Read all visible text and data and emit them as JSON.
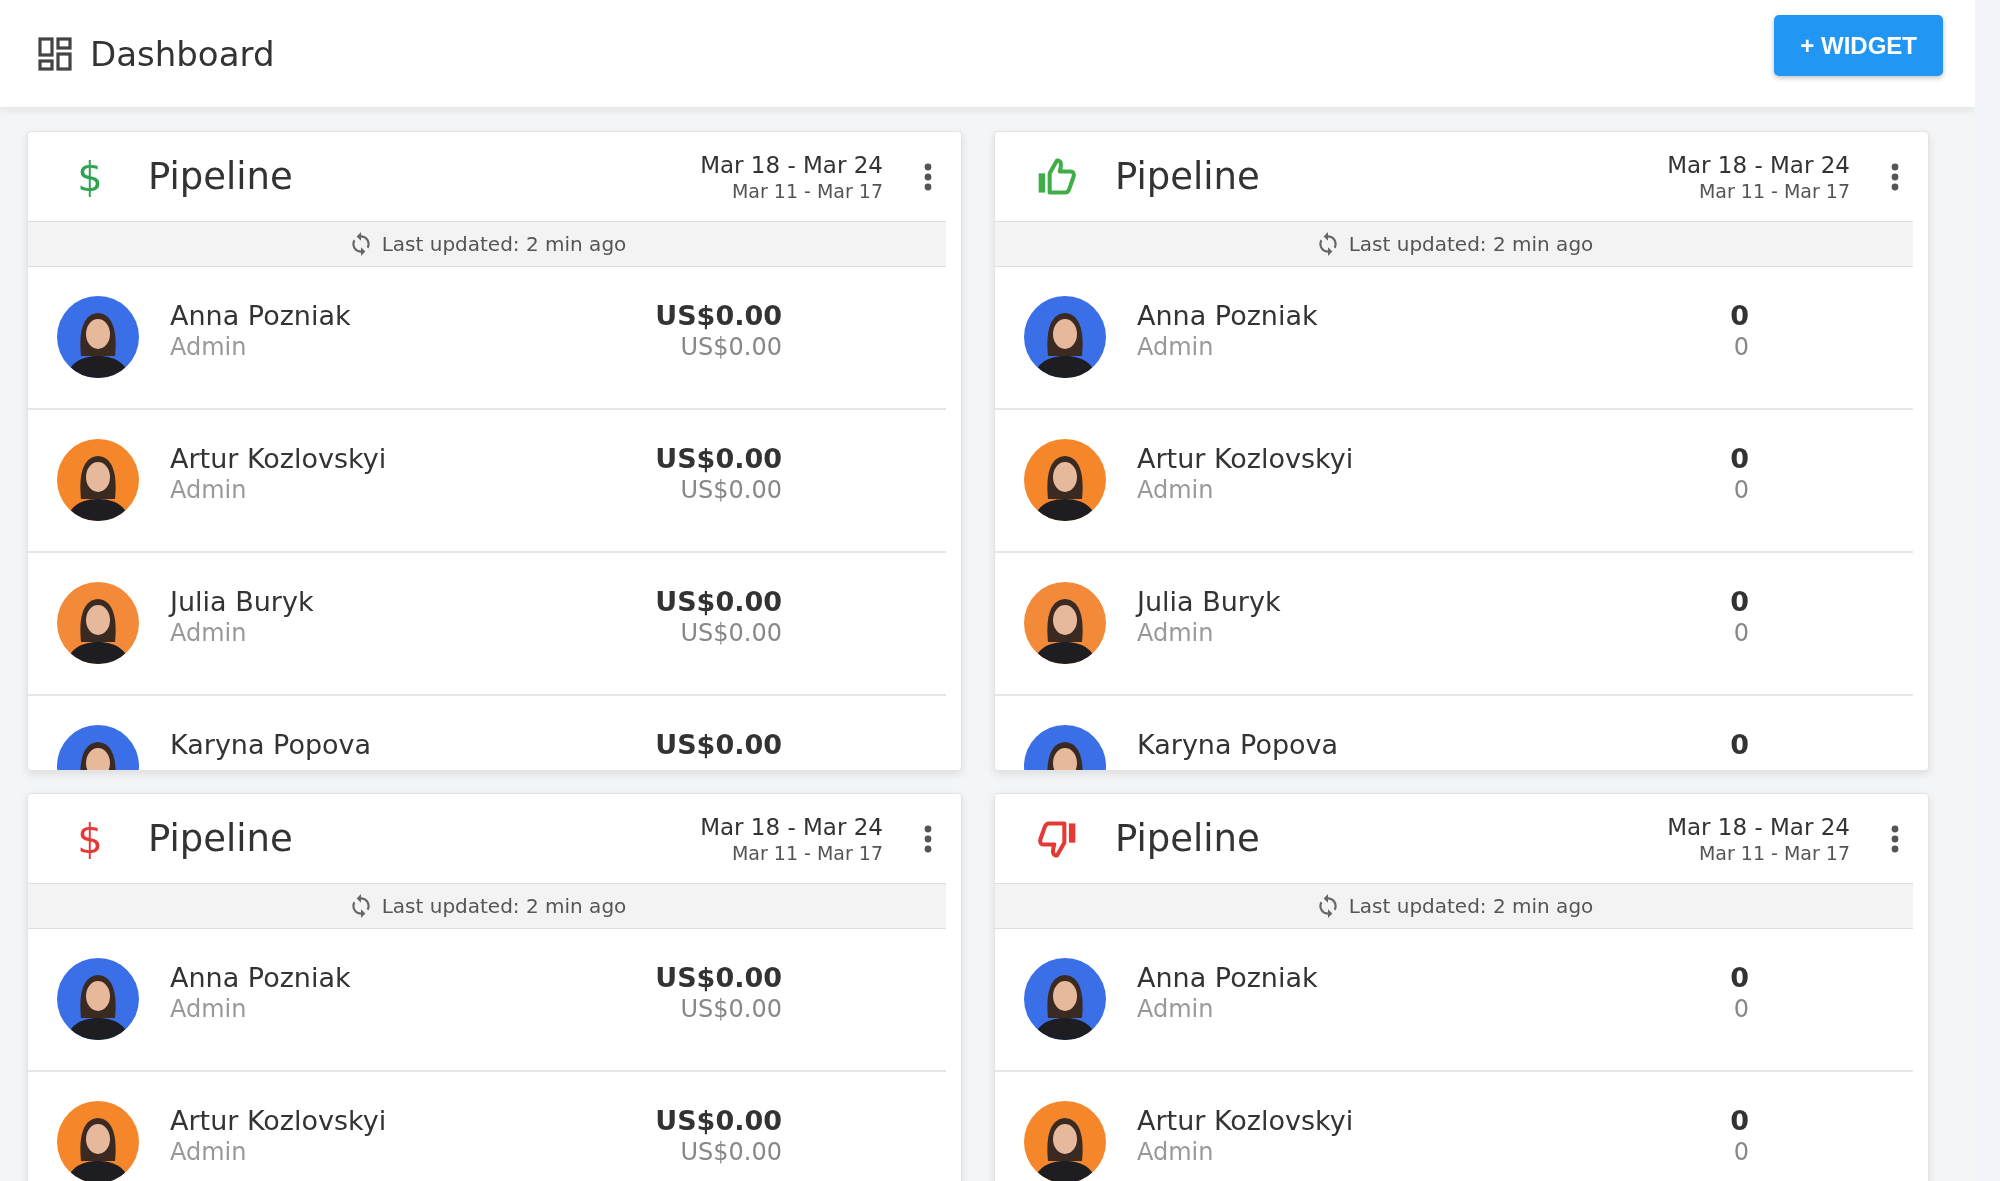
{
  "header": {
    "title": "Dashboard",
    "add_button": "+ WIDGET"
  },
  "widgets": [
    {
      "title": "Pipeline",
      "icon": {
        "kind": "glyph",
        "glyph": "$"
      },
      "color": "#2ea44f",
      "current_range": "Mar 18 - Mar 24",
      "previous_range": "Mar 11 - Mar 17",
      "updated": "Last updated: 2 min ago",
      "rows": [
        {
          "name": "Anna Pozniak",
          "role": "Admin",
          "color": "#3b6fe8",
          "value": "US$0.00",
          "previous": "US$0.00"
        },
        {
          "name": "Artur Kozlovskyi",
          "role": "Admin",
          "color": "#f5872a",
          "value": "US$0.00",
          "previous": "US$0.00"
        },
        {
          "name": "Julia Buryk",
          "role": "Admin",
          "color": "#f28a3a",
          "value": "US$0.00",
          "previous": "US$0.00"
        },
        {
          "name": "Karyna Popova",
          "color": "#3b6fe8",
          "value": "US$0.00"
        }
      ]
    },
    {
      "title": "Pipeline",
      "icon": {
        "kind": "thumbs-up"
      },
      "color": "#3fae49",
      "current_range": "Mar 18 - Mar 24",
      "previous_range": "Mar 11 - Mar 17",
      "updated": "Last updated: 2 min ago",
      "rows": [
        {
          "name": "Anna Pozniak",
          "role": "Admin",
          "color": "#3b6fe8",
          "value": "0",
          "previous": "0"
        },
        {
          "name": "Artur Kozlovskyi",
          "role": "Admin",
          "color": "#f5872a",
          "value": "0",
          "previous": "0"
        },
        {
          "name": "Julia Buryk",
          "role": "Admin",
          "color": "#f28a3a",
          "value": "0",
          "previous": "0"
        },
        {
          "name": "Karyna Popova",
          "color": "#3b6fe8",
          "value": "0"
        }
      ]
    },
    {
      "title": "Pipeline",
      "icon": {
        "kind": "glyph",
        "glyph": "$"
      },
      "color": "#e53935",
      "current_range": "Mar 18 - Mar 24",
      "previous_range": "Mar 11 - Mar 17",
      "updated": "Last updated: 2 min ago",
      "rows": [
        {
          "name": "Anna Pozniak",
          "role": "Admin",
          "color": "#3b6fe8",
          "value": "US$0.00",
          "previous": "US$0.00"
        },
        {
          "name": "Artur Kozlovskyi",
          "role": "Admin",
          "color": "#f5872a",
          "value": "US$0.00",
          "previous": "US$0.00"
        }
      ]
    },
    {
      "title": "Pipeline",
      "icon": {
        "kind": "thumbs-down"
      },
      "color": "#e53935",
      "current_range": "Mar 18 - Mar 24",
      "previous_range": "Mar 11 - Mar 17",
      "updated": "Last updated: 2 min ago",
      "rows": [
        {
          "name": "Anna Pozniak",
          "role": "Admin",
          "color": "#3b6fe8",
          "value": "0",
          "previous": "0"
        },
        {
          "name": "Artur Kozlovskyi",
          "role": "Admin",
          "color": "#f5872a",
          "value": "0",
          "previous": "0"
        }
      ]
    }
  ]
}
